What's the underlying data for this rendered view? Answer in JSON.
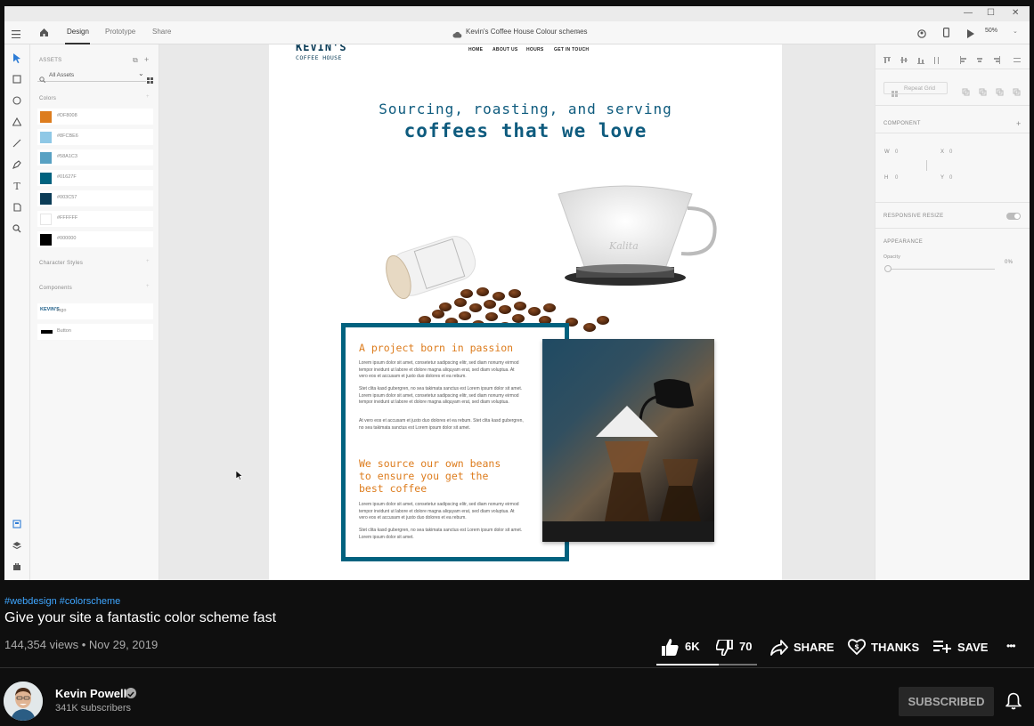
{
  "window": {
    "min": "—",
    "max": "☐",
    "close": "✕"
  },
  "tabs": {
    "design": "Design",
    "prototype": "Prototype",
    "share": "Share"
  },
  "doc_title": "Kevin's Coffee House Colour schemes",
  "zoom": "50%",
  "assets": {
    "title": "ASSETS",
    "search_placeholder": "All Assets",
    "colors_label": "Colors",
    "colors": [
      {
        "hex": "#DD7C1D",
        "label": "#DF8008"
      },
      {
        "hex": "#8FC8E6",
        "label": "#8FCBE6"
      },
      {
        "hex": "#58A1C3",
        "label": "#58A1C3"
      },
      {
        "hex": "#01627F",
        "label": "#01627F"
      },
      {
        "hex": "#0B3C57",
        "label": "#003C57"
      },
      {
        "hex": "#FFFFFF",
        "label": "#FFFFFF"
      },
      {
        "hex": "#000000",
        "label": "#000000"
      }
    ],
    "char_styles_label": "Character Styles",
    "components_label": "Components",
    "components": [
      {
        "label": "logo"
      },
      {
        "label": "Button"
      }
    ]
  },
  "props": {
    "repeat_grid": "Repeat Grid",
    "component": "COMPONENT",
    "w_label": "W",
    "w_val": "0",
    "x_label": "X",
    "x_val": "0",
    "h_label": "H",
    "h_val": "0",
    "y_label": "Y",
    "y_val": "0",
    "responsive": "RESPONSIVE RESIZE",
    "appearance": "APPEARANCE",
    "opacity_label": "Opacity",
    "opacity_val": "0%"
  },
  "artboard": {
    "logo_top": "KEVIN'S",
    "logo_bottom": "COFFEE HOUSE",
    "nav": [
      "HOME",
      "ABOUT US",
      "HOURS",
      "GET IN TOUCH"
    ],
    "hero_line1": "Sourcing, roasting, and serving",
    "hero_line2": "coffees that we love",
    "card_h1": "A project born in passion",
    "p1": "Lorem ipsum dolor sit amet, consetetur sadipscing elitr, sed diam nonumy eirmod tempor invidunt ut labore et dolore magna aliquyam erat, sed diam voluptua. At vero eos et accusam et justo duo dolores et ea rebum.",
    "p2": "Stet clita kasd gubergren, no sea takimata sanctus est Lorem ipsum dolor sit amet. Lorem ipsum dolor sit amet, consetetur sadipscing elitr, sed diam nonumy eirmod tempor invidunt ut labore et dolore magna aliquyam erat, sed diam voluptua.",
    "p3": "At vero eos et accusam et justo duo dolores et ea rebum. Stet clita kasd gubergren, no sea takimata sanctus est Lorem ipsum dolor sit amet.",
    "card_h2_1": "We source our own beans",
    "card_h2_2": "to ensure you get the",
    "card_h2_3": "best coffee",
    "p4": "Lorem ipsum dolor sit amet, consetetur sadipscing elitr, sed diam nonumy eirmod tempor invidunt ut labore et dolore magna aliquyam erat, sed diam voluptua. At vero eos et accusam et justo duo dolores et ea rebum.",
    "p5": "Stet clita kasd gubergren, no sea takimata sanctus est Lorem ipsum dolor sit amet. Lorem ipsum dolor sit amet."
  },
  "video": {
    "hashtags": "#webdesign #colorscheme",
    "title": "Give your site a fantastic color scheme fast",
    "meta": "144,354 views • Nov 29, 2019",
    "likes": "6K",
    "dislikes": "70",
    "share": "SHARE",
    "thanks": "THANKS",
    "save": "SAVE",
    "more": "•••"
  },
  "channel": {
    "name": "Kevin Powell",
    "subs": "341K subscribers",
    "subscribe": "SUBSCRIBED"
  },
  "colors": {
    "accent": "#DD7C1D",
    "teal": "#01627F",
    "link": "#3EA6FF"
  }
}
